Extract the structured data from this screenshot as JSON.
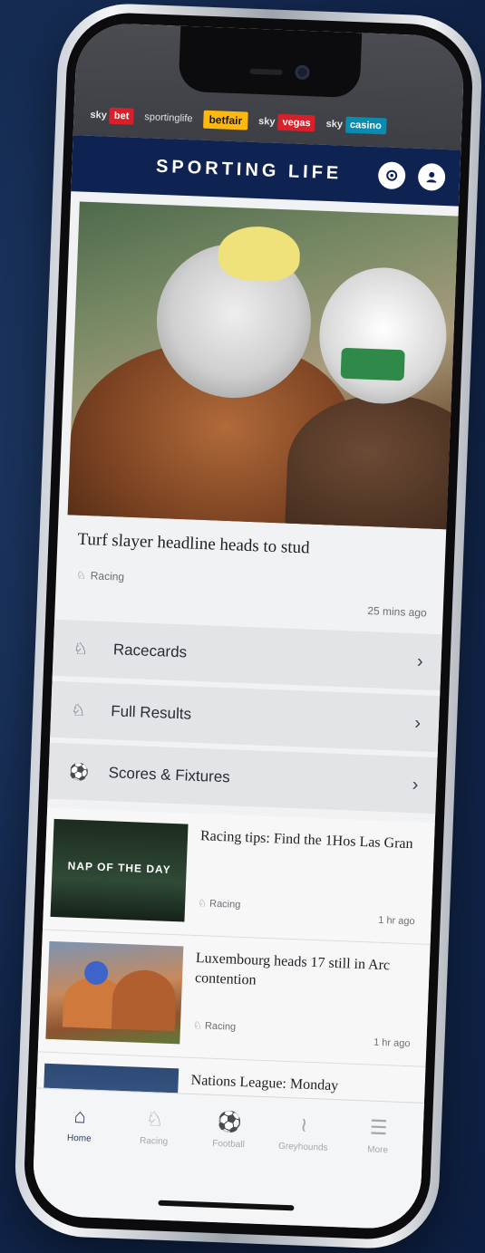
{
  "brands": [
    {
      "sky": "sky",
      "tag": "bet",
      "cls": "bet"
    },
    {
      "text": "sportinglife"
    },
    {
      "text": "betfair"
    },
    {
      "sky": "sky",
      "tag": "vegas",
      "cls": "vegas"
    },
    {
      "sky": "sky",
      "tag": "casino",
      "cls": "casino"
    }
  ],
  "header": {
    "logo": "SPORTING LIFE"
  },
  "hero": {
    "title": "Turf slayer headline heads to stud",
    "tag": "Racing",
    "time": "25 mins ago"
  },
  "menu": [
    {
      "label": "Racecards",
      "icon": "horse-head-icon"
    },
    {
      "label": "Full Results",
      "icon": "horse-head-icon"
    },
    {
      "label": "Scores & Fixtures",
      "icon": "football-icon"
    }
  ],
  "list": [
    {
      "title": "Racing tips: Find the 1Hos Las Gran",
      "tag": "Racing",
      "time": "1 hr ago",
      "thumb_text": "NAP OF THE DAY"
    },
    {
      "title": "Luxembourg heads 17 still in Arc contention",
      "tag": "Racing",
      "time": "1 hr ago"
    },
    {
      "title": "Nations League: Monday",
      "tag": "",
      "time": ""
    }
  ],
  "tabs": [
    {
      "label": "Home",
      "icon": "home-icon",
      "active": true
    },
    {
      "label": "Racing",
      "icon": "horse-head-icon"
    },
    {
      "label": "Football",
      "icon": "football-icon"
    },
    {
      "label": "Greyhounds",
      "icon": "greyhound-icon"
    },
    {
      "label": "More",
      "icon": "more-icon"
    }
  ]
}
